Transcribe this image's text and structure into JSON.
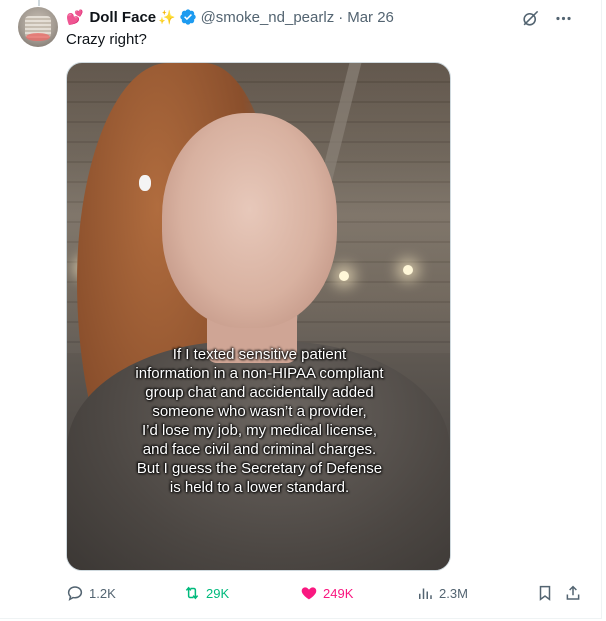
{
  "tweet": {
    "author": {
      "emoji_prefix": "💕",
      "display_name": "Doll Face",
      "name_suffix": "✨",
      "handle": "@smoke_nd_pearlz",
      "separator": "·",
      "date": "Mar 26",
      "verified": true
    },
    "text": "Crazy right?",
    "media": {
      "caption_lines": [
        "If I texted sensitive patient",
        "information in a non-HIPAA compliant",
        "group chat and accidentally added",
        "someone who wasn’t a provider,",
        "I’d lose my job, my medical license,",
        "and face civil and criminal charges.",
        "But I guess the Secretary of Defense",
        "is held to a lower standard."
      ]
    },
    "actions": {
      "replies": "1.2K",
      "reposts": "29K",
      "likes": "249K",
      "views": "2.3M"
    }
  },
  "colors": {
    "text_primary": "#0f1419",
    "text_secondary": "#536471",
    "verified_blue": "#1d9bf0",
    "repost_green": "#00ba7c",
    "like_pink": "#f91880"
  },
  "icons": [
    "grok-icon",
    "more-icon",
    "verified-icon",
    "reply-icon",
    "repost-icon",
    "like-icon",
    "views-icon",
    "bookmark-icon",
    "share-icon"
  ]
}
